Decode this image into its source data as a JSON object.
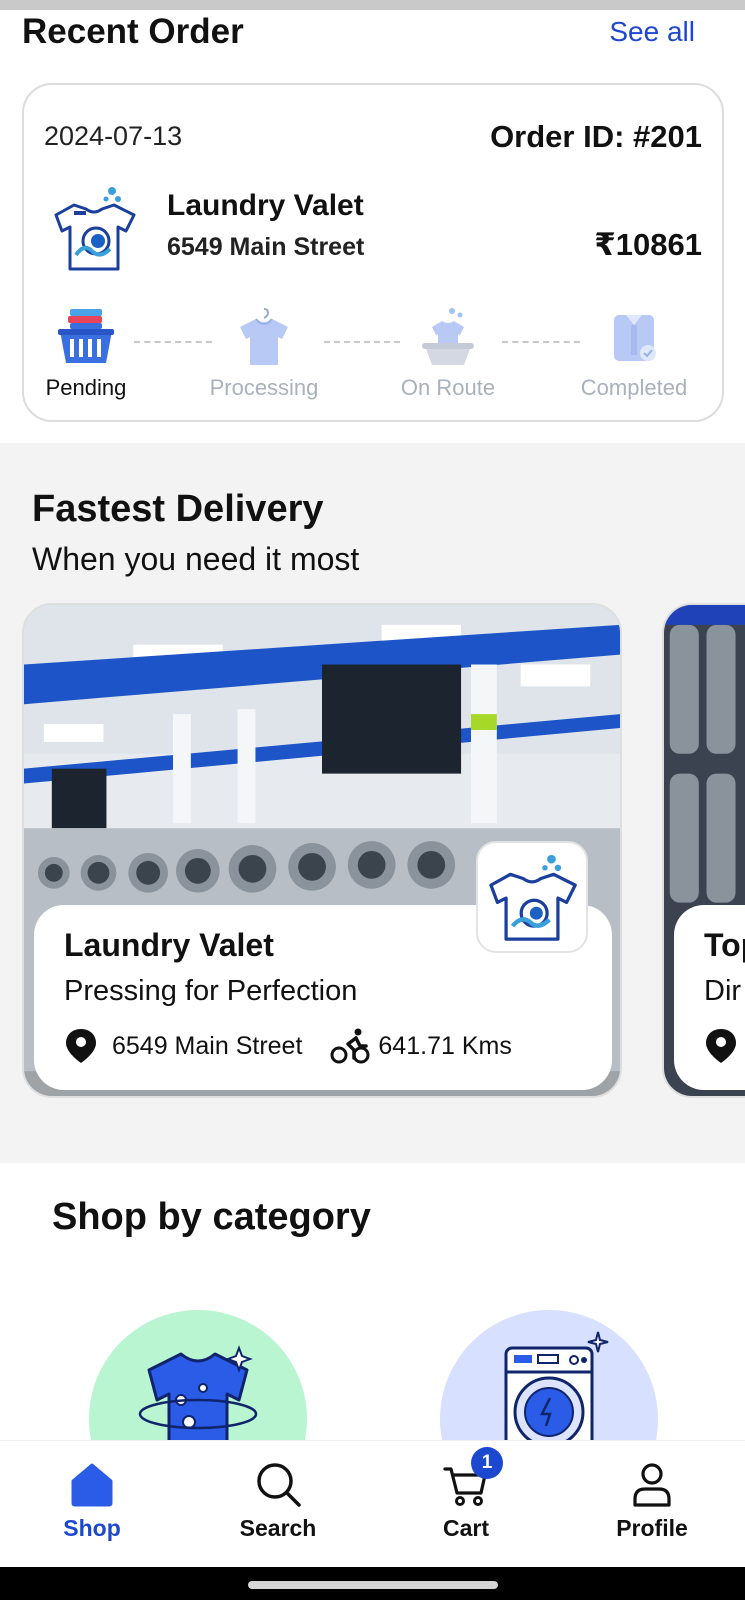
{
  "recent_order": {
    "title": "Recent Order",
    "see_all": "See all",
    "date": "2024-07-13",
    "order_id": "Order ID: #201",
    "shop_name": "Laundry Valet",
    "shop_address": "6549 Main Street",
    "price": "₹10861",
    "steps": [
      {
        "label": "Pending",
        "icon": "laundry-basket-icon",
        "active": true
      },
      {
        "label": "Processing",
        "icon": "shirt-hanger-icon",
        "active": false
      },
      {
        "label": "On Route",
        "icon": "washing-tub-icon",
        "active": false
      },
      {
        "label": "Completed",
        "icon": "folded-shirt-icon",
        "active": false
      }
    ]
  },
  "fastest_delivery": {
    "title": "Fastest Delivery",
    "subtitle": "When you need it most",
    "cards": [
      {
        "name": "Laundry Valet",
        "tagline": "Pressing for Perfection",
        "address": "6549 Main Street",
        "distance": "641.71 Kms"
      },
      {
        "name": "Top",
        "tagline": "Dir"
      }
    ]
  },
  "category": {
    "title": "Shop by category",
    "items": [
      {
        "icon": "tshirt-sparkle-icon",
        "color": "#b9f5d0"
      },
      {
        "icon": "washing-machine-icon",
        "color": "#d8e0ff"
      }
    ]
  },
  "bottom_nav": {
    "items": [
      {
        "label": "Shop",
        "icon": "home-icon",
        "active": true
      },
      {
        "label": "Search",
        "icon": "search-icon",
        "active": false
      },
      {
        "label": "Cart",
        "icon": "cart-icon",
        "active": false,
        "badge": "1"
      },
      {
        "label": "Profile",
        "icon": "profile-icon",
        "active": false
      }
    ]
  },
  "colors": {
    "accent": "#1c48cf",
    "section_bg": "#f3f3f3",
    "inactive_label": "#a9b1bd"
  }
}
